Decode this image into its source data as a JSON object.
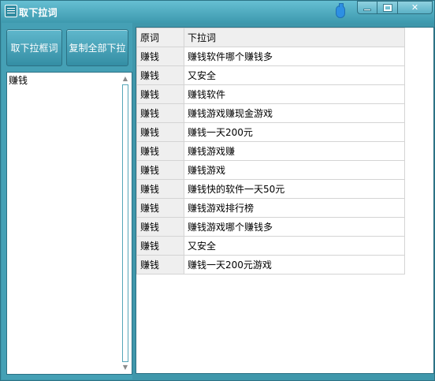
{
  "window": {
    "title": "取下拉词",
    "icon": "app-list-icon",
    "controls": [
      "minimize",
      "maximize",
      "close"
    ],
    "close_label": "✕"
  },
  "buttons": {
    "fetch_label": "取下拉框词",
    "copy_all_label": "复制全部下拉"
  },
  "input": {
    "value": "赚钱"
  },
  "table": {
    "headers": [
      "原词",
      "下拉词"
    ],
    "rows": [
      [
        "赚钱",
        "赚钱软件哪个赚钱多"
      ],
      [
        "赚钱",
        "又安全"
      ],
      [
        "赚钱",
        "赚钱软件"
      ],
      [
        "赚钱",
        "赚钱游戏赚现金游戏"
      ],
      [
        "赚钱",
        "赚钱一天200元"
      ],
      [
        "赚钱",
        "赚钱游戏赚"
      ],
      [
        "赚钱",
        "赚钱游戏"
      ],
      [
        "赚钱",
        "赚钱快的软件一天50元"
      ],
      [
        "赚钱",
        "赚钱游戏排行榜"
      ],
      [
        "赚钱",
        "赚钱游戏哪个赚钱多"
      ],
      [
        "赚钱",
        "又安全"
      ],
      [
        "赚钱",
        "赚钱一天200元游戏"
      ]
    ]
  },
  "colors": {
    "frame": "#3f97ab",
    "button": "#348ea4",
    "grid": "#d4d4d4"
  }
}
